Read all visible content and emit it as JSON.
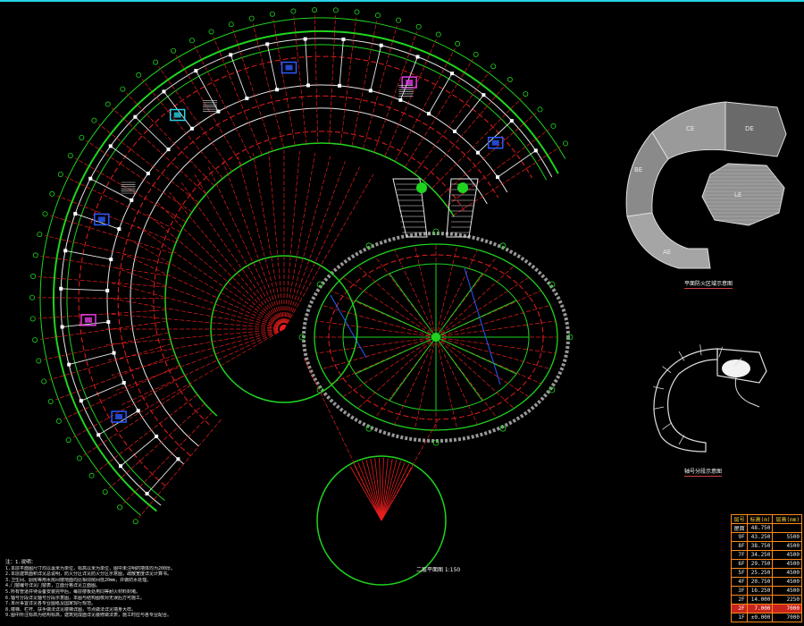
{
  "captions": {
    "zone_map": "平面防火区域示意图",
    "key_plan": "轴号分段示意图",
    "center_title": "二层平面图 1:150"
  },
  "zone_labels": [
    "DE",
    "CE",
    "BE",
    "LE",
    "AE"
  ],
  "notes": {
    "title": "注：1.说明：",
    "lines": [
      "1.本层平面图尺寸均以毫米为单位，标高以米为单位，图中未注明的墙体均为200厚。",
      "2.本层建筑面积详见总说明，防火分区详见防火分区示意图，疏散宽度详见计算书。",
      "3.卫生间、厨房等用水房间楼地面均比相邻房间低20mm，并做防水处理。",
      "4.门窗编号详见门窗表，立面分格详见立面图。",
      "5.所有管道井待设备安装完毕后，每层楼板处用同等耐火材料封堵。",
      "6.轴号分段详见轴号分段示意图，本图与结构图核对无误后方可施工。",
      "7.未尽事宜详见各专业图纸及国家现行规范。",
      "8.楼梯、栏杆、扶手做法详见楼梯详图，节点做法详见墙身大样。",
      "9.图中所注标高为结构标高，建筑完成面详见装修做法表，施工时应与各专业配合。"
    ]
  },
  "table": {
    "headers": [
      "层号",
      "标高(m)",
      "层高(mm)"
    ],
    "rows": [
      [
        "屋面",
        "48.750",
        ""
      ],
      [
        "9F",
        "43.250",
        "5500"
      ],
      [
        "8F",
        "38.750",
        "4500"
      ],
      [
        "7F",
        "34.250",
        "4500"
      ],
      [
        "6F",
        "29.750",
        "4500"
      ],
      [
        "5F",
        "25.250",
        "4500"
      ],
      [
        "4F",
        "20.750",
        "4500"
      ],
      [
        "3F",
        "16.250",
        "4500"
      ],
      [
        "2F",
        "14.000",
        "2250"
      ],
      [
        "2F",
        "7.000",
        "7000"
      ],
      [
        "1F",
        "±0.000",
        "7000"
      ]
    ],
    "highlight_row": 9
  },
  "colors": {
    "grid": "#1fd41f",
    "axis_lines": "#e81e1e",
    "walls": "#e8e8e8",
    "columns": "#ffffff",
    "accent_blue": "#2a5bff",
    "accent_magenta": "#e43ae4",
    "accent_cyan": "#2ad2e8",
    "accent_yellow": "#ffd23a"
  }
}
